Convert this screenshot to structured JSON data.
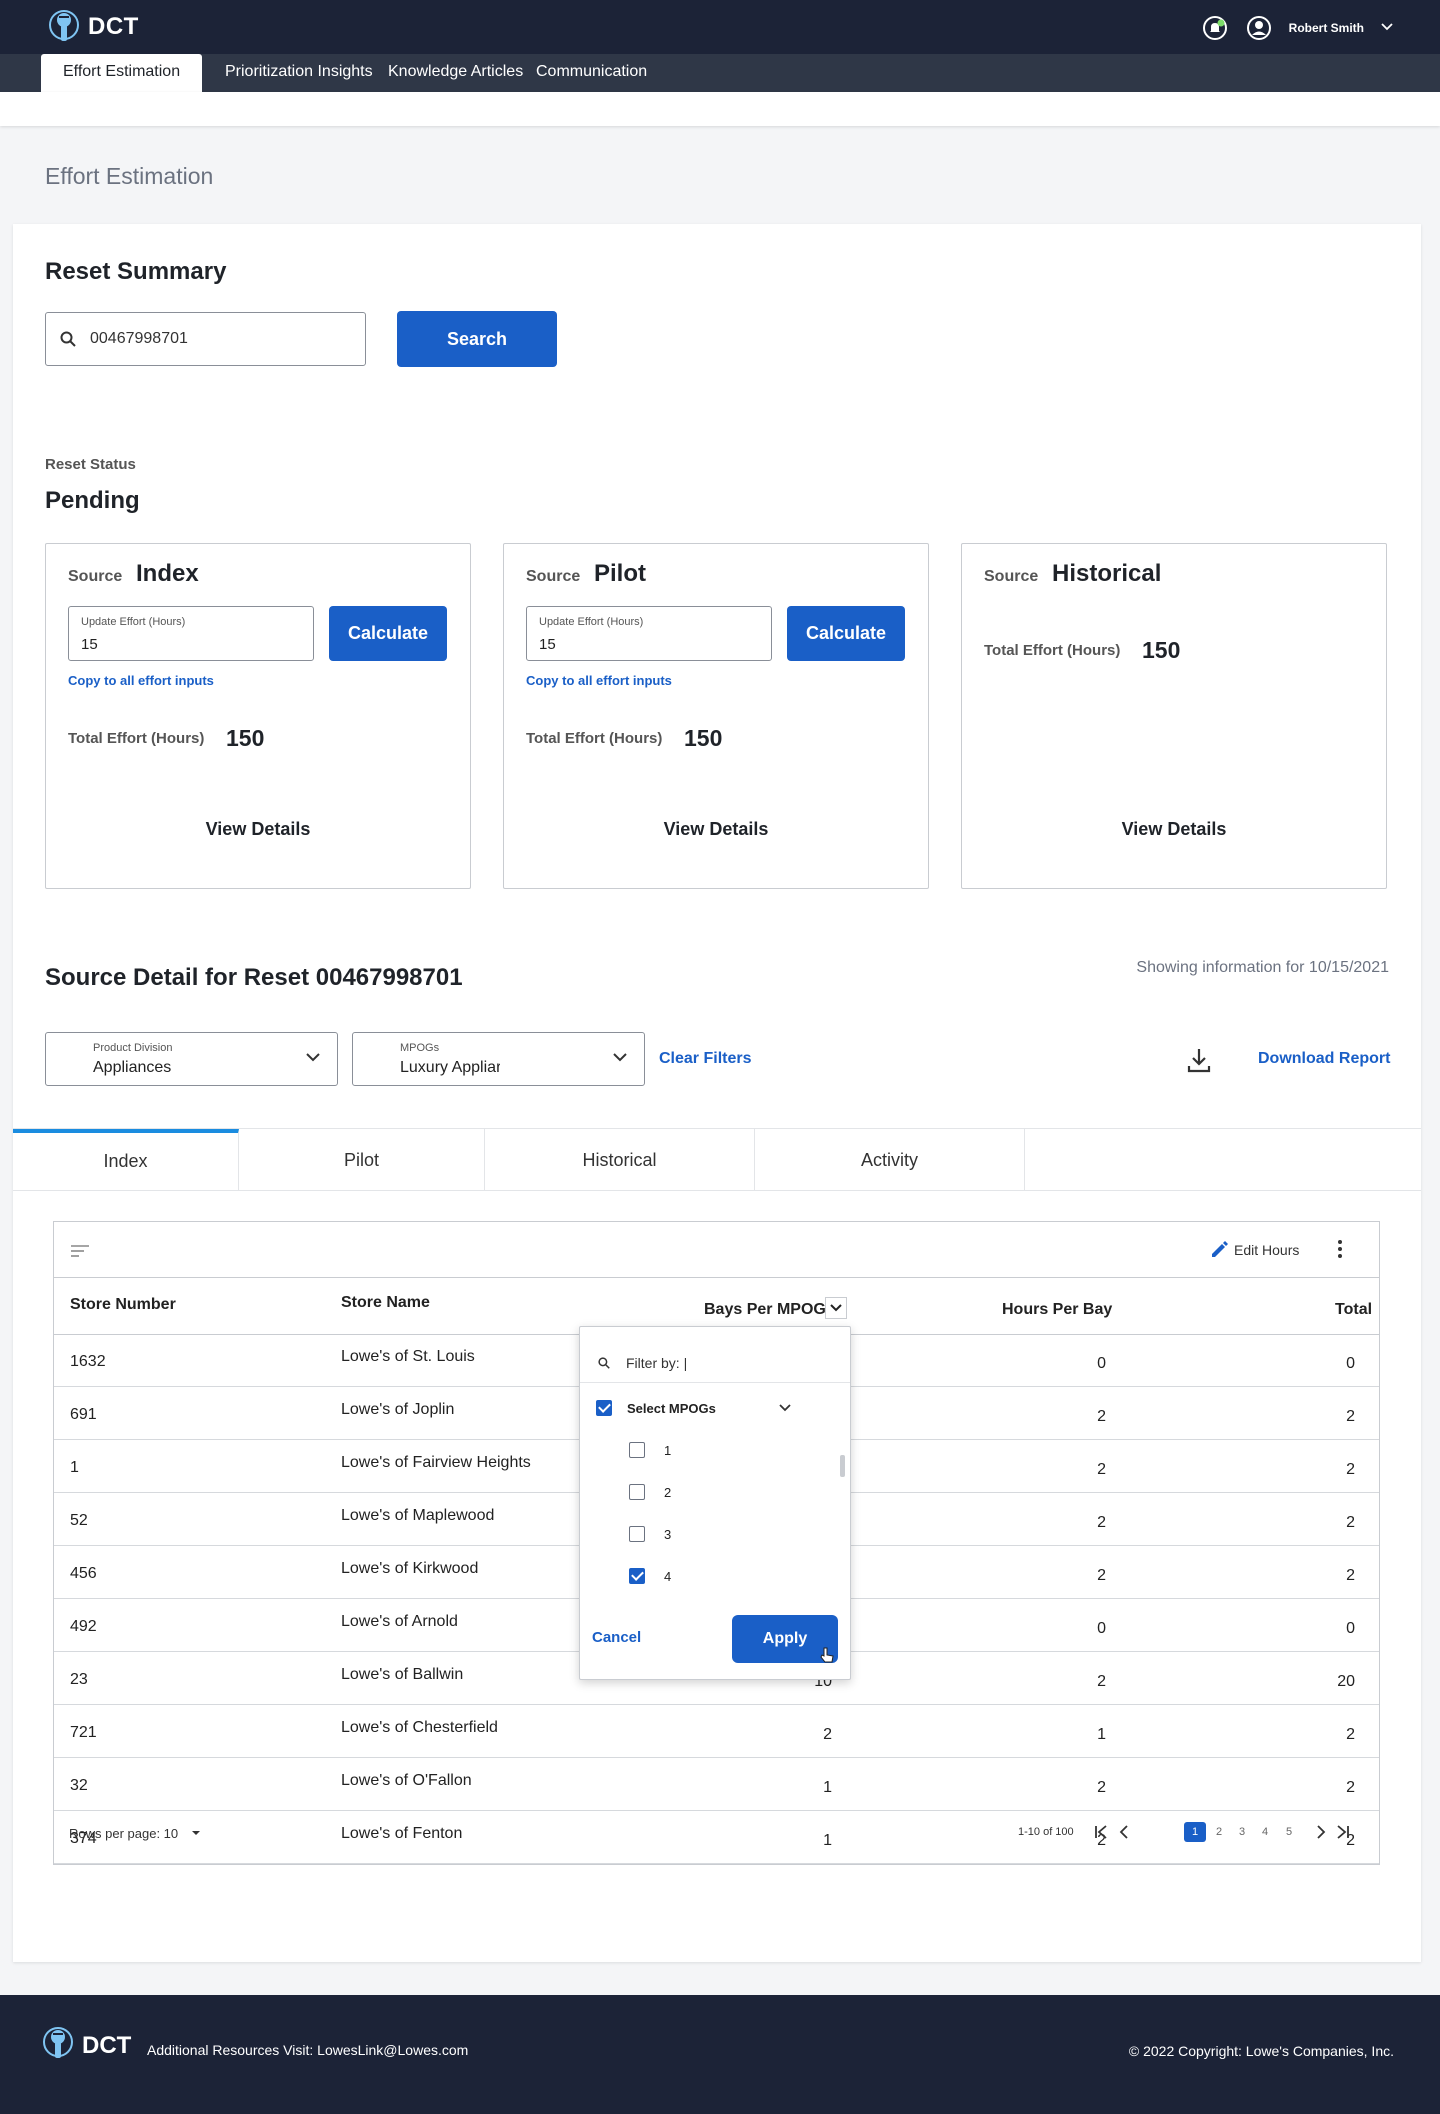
{
  "app": {
    "name": "DCT",
    "user": "Robert Smith"
  },
  "nav": {
    "tabs": [
      {
        "label": "Effort Estimation",
        "active": true
      },
      {
        "label": "Prioritization Insights"
      },
      {
        "label": "Knowledge Articles"
      },
      {
        "label": "Communication"
      }
    ]
  },
  "page": {
    "title": "Effort Estimation"
  },
  "reset_summary": {
    "heading": "Reset Summary",
    "search_value": "00467998701",
    "search_button": "Search",
    "status_label": "Reset Status",
    "status_value": "Pending"
  },
  "sources": [
    {
      "label": "Source",
      "name": "Index",
      "field_label": "Update Effort (Hours)",
      "field_value": "15",
      "calc_button": "Calculate",
      "copy_link": "Copy to all effort inputs",
      "total_label": "Total Effort (Hours)",
      "total_value": "150",
      "view_details": "View Details"
    },
    {
      "label": "Source",
      "name": "Pilot",
      "field_label": "Update Effort (Hours)",
      "field_value": "15",
      "calc_button": "Calculate",
      "copy_link": "Copy to all effort inputs",
      "total_label": "Total Effort (Hours)",
      "total_value": "150",
      "view_details": "View Details"
    },
    {
      "label": "Source",
      "name": "Historical",
      "total_label": "Total Effort (Hours)",
      "total_value": "150",
      "view_details": "View Details"
    }
  ],
  "source_detail": {
    "heading": "Source Detail for Reset 00467998701",
    "showing_info": "Showing information for 10/15/2021",
    "product_division": {
      "label": "Product Division",
      "value": "Appliances"
    },
    "mpogs": {
      "label": "MPOGs",
      "value": "Luxury Appliar"
    },
    "clear_filters": "Clear Filters",
    "download_report": "Download Report",
    "tabs": [
      "Index",
      "Pilot",
      "Historical",
      "Activity"
    ],
    "active_tab": "Index"
  },
  "table": {
    "edit_hours": "Edit Hours",
    "columns": [
      "Store Number",
      "Store Name",
      "Bays Per MPOG",
      "Hours Per Bay",
      "Total"
    ],
    "rows": [
      {
        "store_number": "1632",
        "store_name": "Lowe's of St. Louis",
        "bays": "",
        "hours": "0",
        "total": "0"
      },
      {
        "store_number": "691",
        "store_name": "Lowe's of Joplin",
        "bays": "",
        "hours": "2",
        "total": "2"
      },
      {
        "store_number": "1",
        "store_name": "Lowe's of Fairview Heights",
        "bays": "",
        "hours": "2",
        "total": "2"
      },
      {
        "store_number": "52",
        "store_name": "Lowe's of Maplewood",
        "bays": "",
        "hours": "2",
        "total": "2"
      },
      {
        "store_number": "456",
        "store_name": "Lowe's of Kirkwood",
        "bays": "",
        "hours": "2",
        "total": "2"
      },
      {
        "store_number": "492",
        "store_name": "Lowe's of Arnold",
        "bays": "",
        "hours": "0",
        "total": "0"
      },
      {
        "store_number": "23",
        "store_name": "Lowe's of Ballwin",
        "bays": "10",
        "hours": "2",
        "total": "20"
      },
      {
        "store_number": "721",
        "store_name": "Lowe's of Chesterfield",
        "bays": "2",
        "hours": "1",
        "total": "2"
      },
      {
        "store_number": "32",
        "store_name": "Lowe's of O'Fallon",
        "bays": "1",
        "hours": "2",
        "total": "2"
      },
      {
        "store_number": "374",
        "store_name": "Lowe's of Fenton",
        "bays": "1",
        "hours": "2",
        "total": "2"
      }
    ],
    "rows_per_page_label": "Rows per page: 10",
    "range_label": "1-10 of 100",
    "pages": [
      "1",
      "2",
      "3",
      "4",
      "5"
    ],
    "current_page": "1"
  },
  "filter_popover": {
    "filter_placeholder": "Filter by: |",
    "select_all_label": "Select MPOGs",
    "options": [
      {
        "label": "1",
        "checked": false
      },
      {
        "label": "2",
        "checked": false
      },
      {
        "label": "3",
        "checked": false
      },
      {
        "label": "4",
        "checked": true
      }
    ],
    "cancel": "Cancel",
    "apply": "Apply"
  },
  "footer": {
    "resources": "Additional Resources Visit: LowesLink@Lowes.com",
    "copyright": "© 2022 Copyright: Lowe's Companies, Inc."
  },
  "colors": {
    "primary": "#1a5fc7",
    "header_bg": "#1c2337",
    "nav_bg": "#2f3747",
    "tab_accent": "#1a8ce0"
  }
}
